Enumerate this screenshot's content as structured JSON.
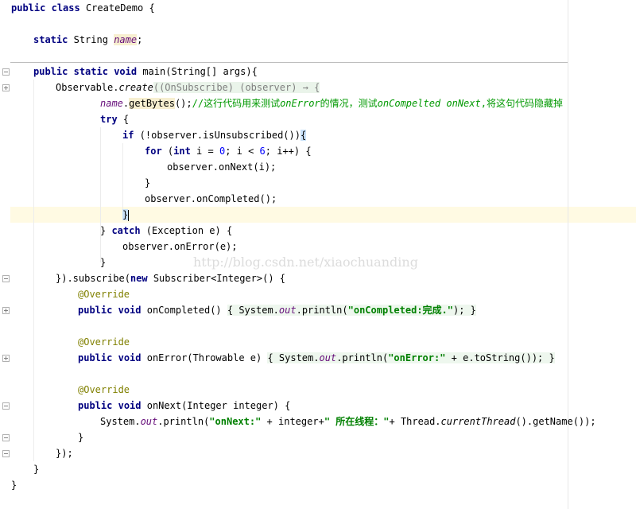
{
  "class_name": "CreateDemo",
  "field_name": "name",
  "lines": {
    "l1": {
      "kw1": "public",
      "kw2": "class",
      "name": "CreateDemo",
      "brace": "{"
    },
    "l3": {
      "kw": "static",
      "type": "String",
      "name": "name",
      "semi": ";"
    },
    "l5": {
      "kw1": "public",
      "kw2": "static",
      "kw3": "void",
      "rest": "main(String[] args){"
    },
    "l6": {
      "a": "Observable.",
      "create": "create",
      "lambda": "((OnSubscribe) (observer) → {"
    },
    "l7": {
      "name": "name",
      "dot": ".",
      "method": "getBytes",
      "after": "();",
      "comment_a": "//这行代码用来测试",
      "comment_b": "onError",
      "comment_c": "的情况，测试",
      "comment_d": "onCompelted onNext",
      "comment_e": ",将这句代码隐藏掉"
    },
    "l8": {
      "kw": "try",
      "rest": " {"
    },
    "l9": {
      "kw": "if",
      "rest": " (!observer.isUnsubscribed())",
      "brace": "{"
    },
    "l10": {
      "kw": "for",
      "p1": " (",
      "kw2": "int",
      "p2": " i = ",
      "n1": "0",
      "p3": "; i < ",
      "n2": "6",
      "p4": "; i++) {"
    },
    "l11": {
      "text": "observer.onNext(i);"
    },
    "l12": {
      "text": "}"
    },
    "l13": {
      "text": "observer.onCompleted();"
    },
    "l14": {
      "text": "}"
    },
    "l15": {
      "p1": "} ",
      "kw": "catch",
      "p2": " (Exception e) {"
    },
    "l16": {
      "text": "observer.onError(e);"
    },
    "l17": {
      "text": "}"
    },
    "l18": {
      "p1": "}).subscribe(",
      "kw": "new",
      "p2": " Subscriber<Integer>() {"
    },
    "l19": {
      "ann": "@Override"
    },
    "l20": {
      "kw1": "public",
      "kw2": "void",
      "p1": " onCompleted() ",
      "fold_a": "{ System.",
      "out": "out",
      "fold_b": ".println(",
      "str": "\"onCompleted:完成.\"",
      "fold_c": "); }"
    },
    "l22": {
      "ann": "@Override"
    },
    "l23": {
      "kw1": "public",
      "kw2": "void",
      "p1": " onError(Throwable e) ",
      "fold_a": "{ System.",
      "out": "out",
      "fold_b": ".println(",
      "str": "\"onError:\"",
      "fold_c": " + e.toString()); }"
    },
    "l25": {
      "ann": "@Override"
    },
    "l26": {
      "kw1": "public",
      "kw2": "void",
      "p1": " onNext(Integer integer) {"
    },
    "l27": {
      "a": "System.",
      "out": "out",
      "b": ".println(",
      "s1": "\"onNext:\"",
      "c": " + integer+",
      "s2": "\" 所在线程：\"",
      "d": "+ Thread.",
      "ct": "currentThread",
      "e": "().getName());"
    },
    "l28": {
      "text": "}"
    },
    "l29": {
      "text": "});"
    },
    "l30": {
      "text": "}"
    },
    "l31": {
      "text": "}"
    }
  },
  "watermark": "http://blog.csdn.net/xiaochuanding"
}
